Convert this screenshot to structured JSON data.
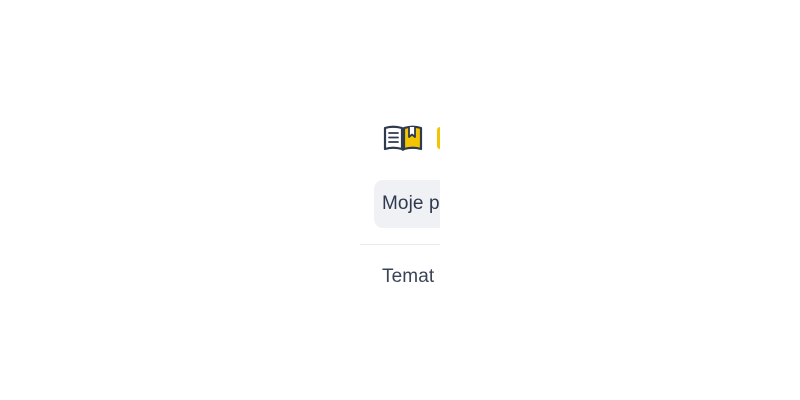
{
  "sidebar": {
    "brand": {
      "icon": "open-book-icon",
      "accent_color": "#f5c400"
    },
    "items": [
      {
        "label": "Moje p",
        "active": true
      },
      {
        "label": "Temat",
        "active": false
      }
    ]
  },
  "colors": {
    "icon_outline": "#2f3a4e",
    "active_bg": "#eff1f5",
    "divider": "#e7e9ee",
    "text": "#2f3a4e"
  }
}
